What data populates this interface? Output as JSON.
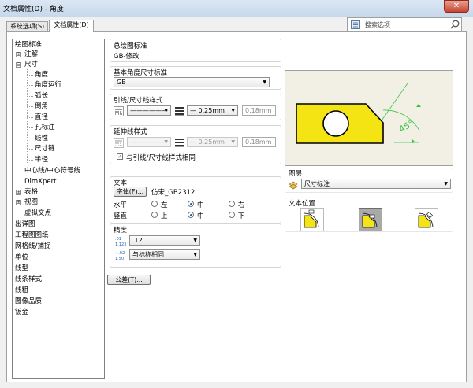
{
  "window": {
    "title": "文档属性(D) - 角度",
    "close_glyph": "✕"
  },
  "tabs": [
    {
      "label": "系统选项(S)"
    },
    {
      "label": "文档属性(D)"
    }
  ],
  "search": {
    "placeholder": "搜索选项"
  },
  "tree": {
    "items": [
      "绘图标准",
      "注解",
      "尺寸",
      "角度",
      "角度运行",
      "弧长",
      "倒角",
      "直径",
      "孔标注",
      "线性",
      "尺寸链",
      "半径",
      "中心线/中心符号线",
      "DimXpert",
      "表格",
      "视图",
      "虚拟交点",
      "出详图",
      "工程图图纸",
      "网格线/捕捉",
      "单位",
      "线型",
      "线条样式",
      "线粗",
      "图像品质",
      "钣金"
    ],
    "expand": "⊞",
    "collapse": "⊟"
  },
  "overall": {
    "label": "总绘图标准",
    "value": "GB-修改"
  },
  "base": {
    "label": "基本角度尺寸标准",
    "value": "GB"
  },
  "leader": {
    "label": "引线/尺寸线样式",
    "style": "——————",
    "thickness": "— 0.25mm",
    "width": "0.18mm"
  },
  "ext": {
    "label": "延伸线样式",
    "style": "——————",
    "thickness": "— 0.25mm",
    "width": "0.18mm",
    "same_label": "与引线/尺寸线样式相同"
  },
  "text": {
    "label": "文本",
    "font_button": "字体(F)...",
    "font_name": "仿宋_GB2312",
    "horiz_label": "水平:",
    "vert_label": "竖直:",
    "h_left": "左",
    "h_center": "中",
    "h_right": "右",
    "v_top": "上",
    "v_center": "中",
    "v_bottom": "下"
  },
  "precision": {
    "label": "精度",
    "primary": ".12",
    "secondary": "与标称相同"
  },
  "tolerance_button": "公差(T)...",
  "preview": {
    "angle_text": "45°"
  },
  "layer": {
    "label": "图层",
    "value": "尺寸标注"
  },
  "textpos": {
    "label": "文本位置"
  },
  "colors": {
    "accent": "#1f5ea8",
    "preview_bg": "#f2f0e4",
    "part_fill": "#f5e414",
    "dim": "#39c24a"
  }
}
